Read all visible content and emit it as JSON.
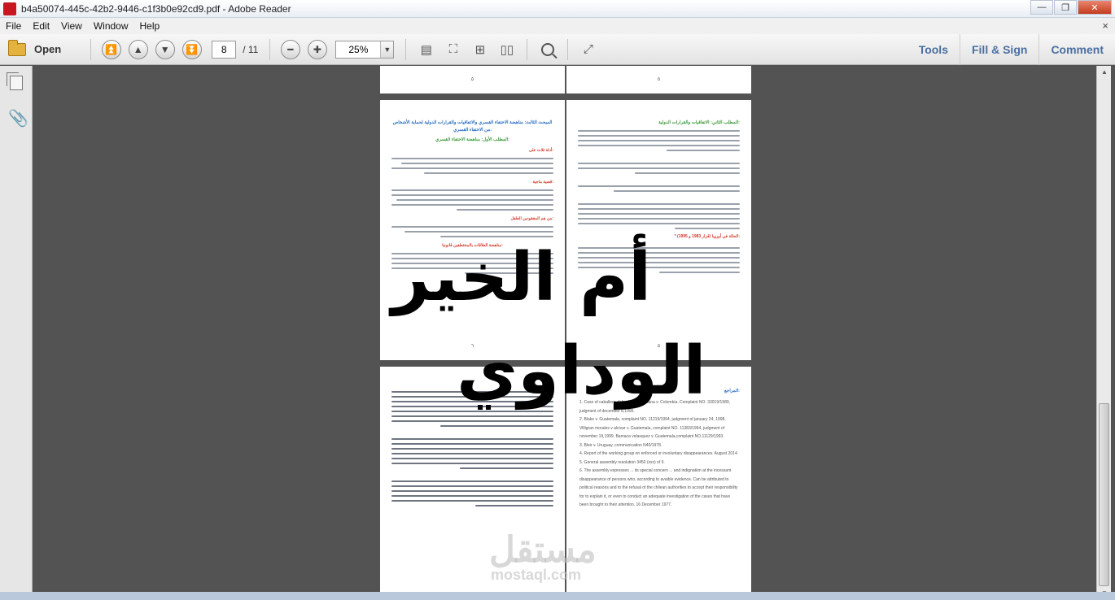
{
  "window": {
    "title": "b4a50074-445c-42b2-9446-c1f3b0e92cd9.pdf - Adobe Reader",
    "controls": {
      "minimize": "—",
      "restore": "❐",
      "close": "✕"
    }
  },
  "menu": {
    "items": [
      "File",
      "Edit",
      "View",
      "Window",
      "Help"
    ],
    "close": "×"
  },
  "toolbar": {
    "open_label": "Open",
    "current_page": "8",
    "total_pages": "/ 11",
    "zoom": "25%",
    "zoom_arrow": "▼",
    "tools_label": "Tools",
    "fill_sign_label": "Fill & Sign",
    "comment_label": "Comment"
  },
  "pages": {
    "top_left_number": "٥",
    "top_right_number": "٥",
    "mid_left_number": "٦",
    "mid_right_number": "٥",
    "mid_left_heading": "المبحث الثالث: مناهضة الاختفاء القسري والاتفاقيات والقرارات الدولية لحماية الأشخاص من الاختفاء القسري.",
    "mid_left_sub": "المطلب الأول: مناهضة الاختفاء القسري:",
    "mid_left_red1": "أدلة ثلاث على:",
    "mid_left_red2": "قضية ماجية:",
    "mid_left_red3": "من هم المفقودين الطفل:",
    "mid_left_red4": "مناهضة العلاقات بالمختطفين قانونيا:",
    "mid_right_heading": "المطلب الثاني: الاتفاقيات والقرارات الدولية:",
    "mid_right_red": "* الحالة في أوروبا (قرار 1983 و 1995):",
    "bottom_right_heading": "المراجع:",
    "references": [
      "1. Case of caballero-delgado and santana v. Colombia. Complaint NO. 33019/1989, judgment of december 8,1995.",
      "2. Blake v. Guatemala, complaint NO. 11219/1994, judgment of january 24, 1998. Villigran morales v alcivar v. Guatemala, complaint NO. 11383/1994, judgment of november 19,1999. Bamaca velasquez v. Guatemala,complaint NO.11129/1993.",
      "3. Bleir v. Uruguay, communication N40/1978.",
      "4. Report of the working group on enforced or involuntary disappearances. August 2014.",
      "5. General assembly resolution 3450 (xxx) of 9.",
      "6. The assembly expresses ... its special concern ... and indignation at the incessant disappearance of persons who, according to avaible evidence. Can be attributed to political reasons and to the refusal of the chilean authorities to accept their responsibility for to explain it, or even to conduct an adequate investigation of the cases that have been brought to their attention. 16 December 1977."
    ]
  },
  "watermark": {
    "line1": "أم الخير",
    "line2": "الوداوي",
    "site_ar": "مستقل",
    "site_url": "mostaql.com"
  },
  "colors": {
    "link_blue": "#4a6fa1",
    "heading_blue": "#2a6fc0",
    "heading_green": "#3e9a3c",
    "heading_red": "#d23a2a"
  }
}
